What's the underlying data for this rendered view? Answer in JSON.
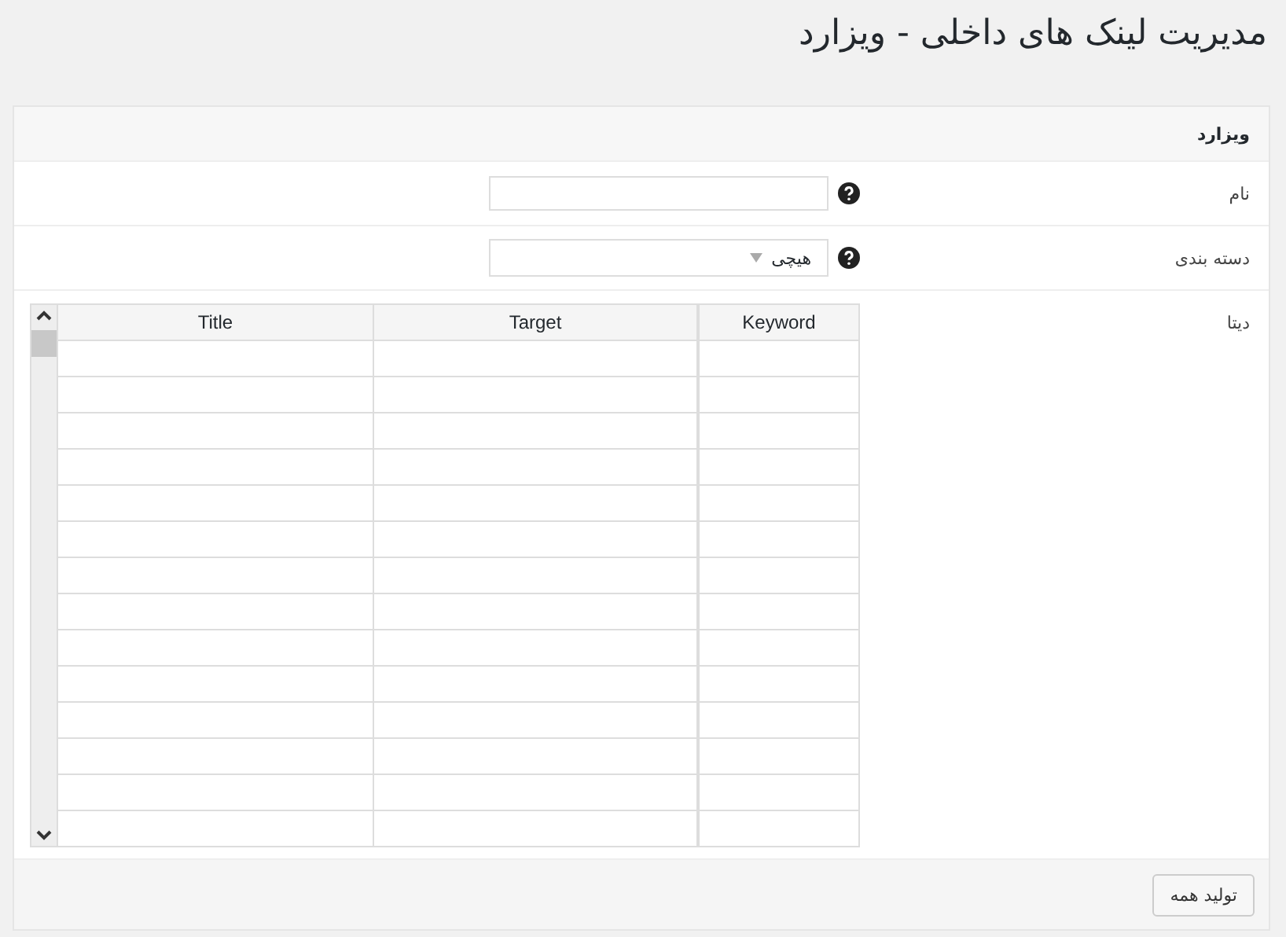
{
  "page_title": "مدیریت لینک های داخلی - ویزارد",
  "panel": {
    "heading": "ویزارد",
    "fields": [
      {
        "kind": "text",
        "label": "نام"
      },
      {
        "kind": "select",
        "label": "دسته بندی",
        "value": "هیچی"
      },
      {
        "kind": "grid",
        "label": "دیتا",
        "columns": [
          "Keyword",
          "Target",
          "Title"
        ]
      }
    ],
    "buttons": [
      "تولید همه"
    ]
  }
}
